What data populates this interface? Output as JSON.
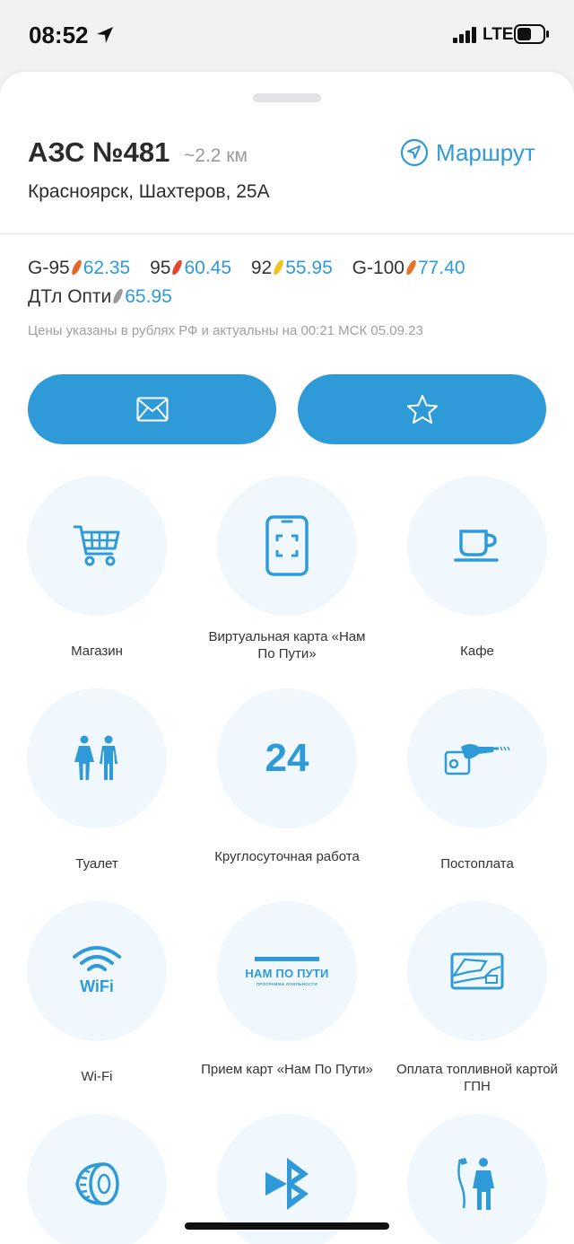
{
  "status_bar": {
    "time": "08:52",
    "network": "LTE"
  },
  "station": {
    "title": "АЗС №481",
    "distance": "~2.2 км",
    "route_label": "Маршрут",
    "address": "Красноярск, Шахтеров, 25А"
  },
  "prices": [
    {
      "fuel": "G-95",
      "value": "62.35",
      "color": "#e8632a"
    },
    {
      "fuel": "95",
      "value": "60.45",
      "color": "#e3452d"
    },
    {
      "fuel": "92",
      "value": "55.95",
      "color": "#f2c21c"
    },
    {
      "fuel": "G-100",
      "value": "77.40",
      "color": "#e8742a"
    },
    {
      "fuel": "ДТл Опти",
      "value": "65.95",
      "color": "#9a9a9a"
    }
  ],
  "price_note": "Цены указаны в рублях РФ и актуальны на 00:21 МСК 05.09.23",
  "services": [
    {
      "label": "Магазин",
      "icon": "cart-icon"
    },
    {
      "label": "Виртуальная карта «Нам По Пути»",
      "icon": "phone-scan-icon"
    },
    {
      "label": "Кафе",
      "icon": "coffee-cup-icon"
    },
    {
      "label": "Туалет",
      "icon": "toilet-icon"
    },
    {
      "label": "Круглосуточная работа",
      "icon": "24h-icon",
      "icon_text": "24"
    },
    {
      "label": "Постоплата",
      "icon": "fuel-nozzle-icon"
    },
    {
      "label": "Wi-Fi",
      "icon": "wifi-icon",
      "icon_text": "WiFi"
    },
    {
      "label": "Прием карт «Нам По Пути»",
      "icon": "nam-po-puti-logo-icon",
      "icon_text": "НАМ ПО ПУТИ",
      "icon_subtext": "ПРОГРАММА ЛОЯЛЬНОСТИ"
    },
    {
      "label": "Оплата топливной картой ГПН",
      "icon": "fuel-card-icon"
    },
    {
      "label": "",
      "icon": "tire-icon"
    },
    {
      "label": "",
      "icon": "bluetooth-icon"
    },
    {
      "label": "",
      "icon": "fuel-attendant-icon"
    }
  ],
  "colors": {
    "accent": "#2e9ad8",
    "circle_bg": "#f1f8fd"
  }
}
